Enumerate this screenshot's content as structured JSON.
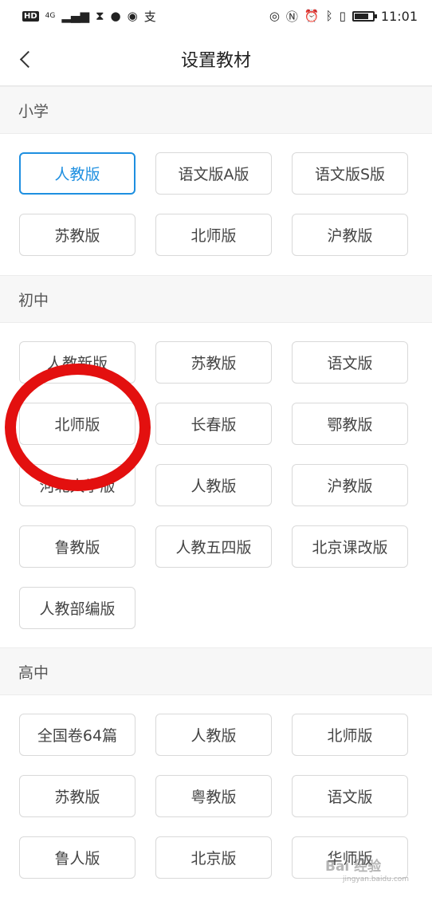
{
  "status_bar": {
    "hd": "HD",
    "network": "4G",
    "time": "11:01",
    "battery_level": 0.8
  },
  "header": {
    "title": "设置教材",
    "back_icon": "chevron-left-icon"
  },
  "accent_color": "#1e8fe0",
  "annotation_color": "#e3100f",
  "sections": [
    {
      "title": "小学",
      "options": [
        {
          "label": "人教版",
          "selected": true
        },
        {
          "label": "语文版A版",
          "selected": false
        },
        {
          "label": "语文版S版",
          "selected": false
        },
        {
          "label": "苏教版",
          "selected": false
        },
        {
          "label": "北师版",
          "selected": false
        },
        {
          "label": "沪教版",
          "selected": false
        }
      ]
    },
    {
      "title": "初中",
      "options": [
        {
          "label": "人教新版",
          "selected": false
        },
        {
          "label": "苏教版",
          "selected": false
        },
        {
          "label": "语文版",
          "selected": false
        },
        {
          "label": "北师版",
          "selected": false
        },
        {
          "label": "长春版",
          "selected": false
        },
        {
          "label": "鄂教版",
          "selected": false
        },
        {
          "label": "河北大学版",
          "selected": false
        },
        {
          "label": "人教版",
          "selected": false
        },
        {
          "label": "沪教版",
          "selected": false
        },
        {
          "label": "鲁教版",
          "selected": false
        },
        {
          "label": "人教五四版",
          "selected": false
        },
        {
          "label": "北京课改版",
          "selected": false
        },
        {
          "label": "人教部编版",
          "selected": false
        }
      ]
    },
    {
      "title": "高中",
      "options": [
        {
          "label": "全国卷64篇",
          "selected": false
        },
        {
          "label": "人教版",
          "selected": false
        },
        {
          "label": "北师版",
          "selected": false
        },
        {
          "label": "苏教版",
          "selected": false
        },
        {
          "label": "粤教版",
          "selected": false
        },
        {
          "label": "语文版",
          "selected": false
        },
        {
          "label": "鲁人版",
          "selected": false
        },
        {
          "label": "北京版",
          "selected": false
        },
        {
          "label": "华师版",
          "selected": false
        }
      ]
    }
  ],
  "watermark": {
    "text": "Bai 经验",
    "sub": "jingyan.baidu.com"
  }
}
